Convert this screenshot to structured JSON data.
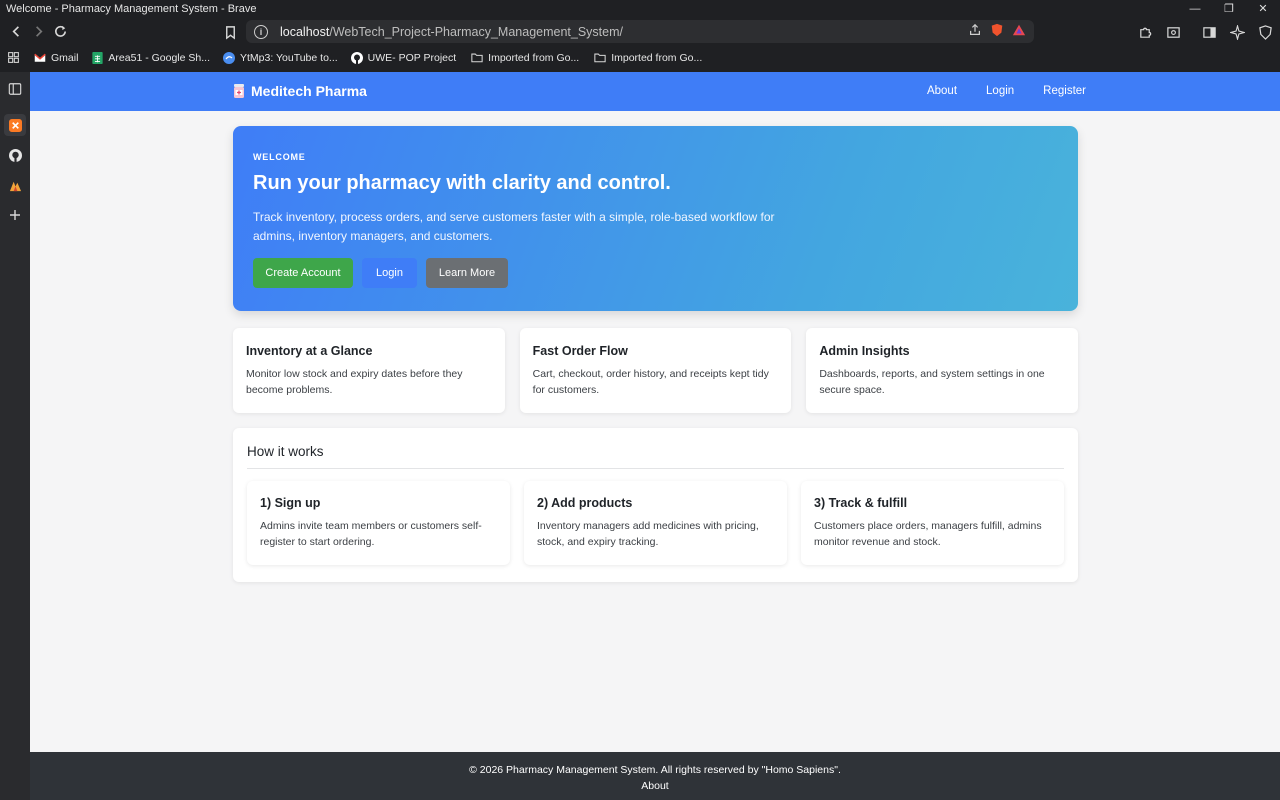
{
  "window": {
    "title": "Welcome - Pharmacy Management System - Brave"
  },
  "browser": {
    "url_host": "localhost",
    "url_path": "/WebTech_Project-Pharmacy_Management_System/"
  },
  "bookmarks": [
    {
      "label": "Gmail",
      "icon": "gmail-icon"
    },
    {
      "label": "Area51 - Google Sh...",
      "icon": "sheets-icon"
    },
    {
      "label": "YtMp3: YouTube to...",
      "icon": "ytmp3-icon"
    },
    {
      "label": "UWE- POP Project",
      "icon": "github-icon"
    },
    {
      "label": "Imported from Go...",
      "icon": "folder-icon"
    },
    {
      "label": "Imported from Go...",
      "icon": "folder-icon"
    }
  ],
  "navbar": {
    "brand": "Meditech Pharma",
    "links": [
      "About",
      "Login",
      "Register"
    ]
  },
  "hero": {
    "eyebrow": "WELCOME",
    "title": "Run your pharmacy with clarity and control.",
    "description": "Track inventory, process orders, and serve customers faster with a simple, role-based workflow for admins, inventory managers, and customers.",
    "buttons": {
      "create": "Create Account",
      "login": "Login",
      "learn": "Learn More"
    }
  },
  "features": [
    {
      "title": "Inventory at a Glance",
      "text": "Monitor low stock and expiry dates before they become problems."
    },
    {
      "title": "Fast Order Flow",
      "text": "Cart, checkout, order history, and receipts kept tidy for customers."
    },
    {
      "title": "Admin Insights",
      "text": "Dashboards, reports, and system settings in one secure space."
    }
  ],
  "how": {
    "title": "How it works",
    "steps": [
      {
        "title": "1) Sign up",
        "text": "Admins invite team members or customers self-register to start ordering."
      },
      {
        "title": "2) Add products",
        "text": "Inventory managers add medicines with pricing, stock, and expiry tracking."
      },
      {
        "title": "3) Track & fulfill",
        "text": "Customers place orders, managers fulfill, admins monitor revenue and stock."
      }
    ]
  },
  "footer": {
    "copyright": "© 2026 Pharmacy Management System. All rights reserved by \"Homo Sapiens\".",
    "link": "About"
  },
  "colors": {
    "primary": "#3f7df7",
    "success": "#3ea64a",
    "secondary": "#6b6f73",
    "footer": "#2f3338"
  }
}
